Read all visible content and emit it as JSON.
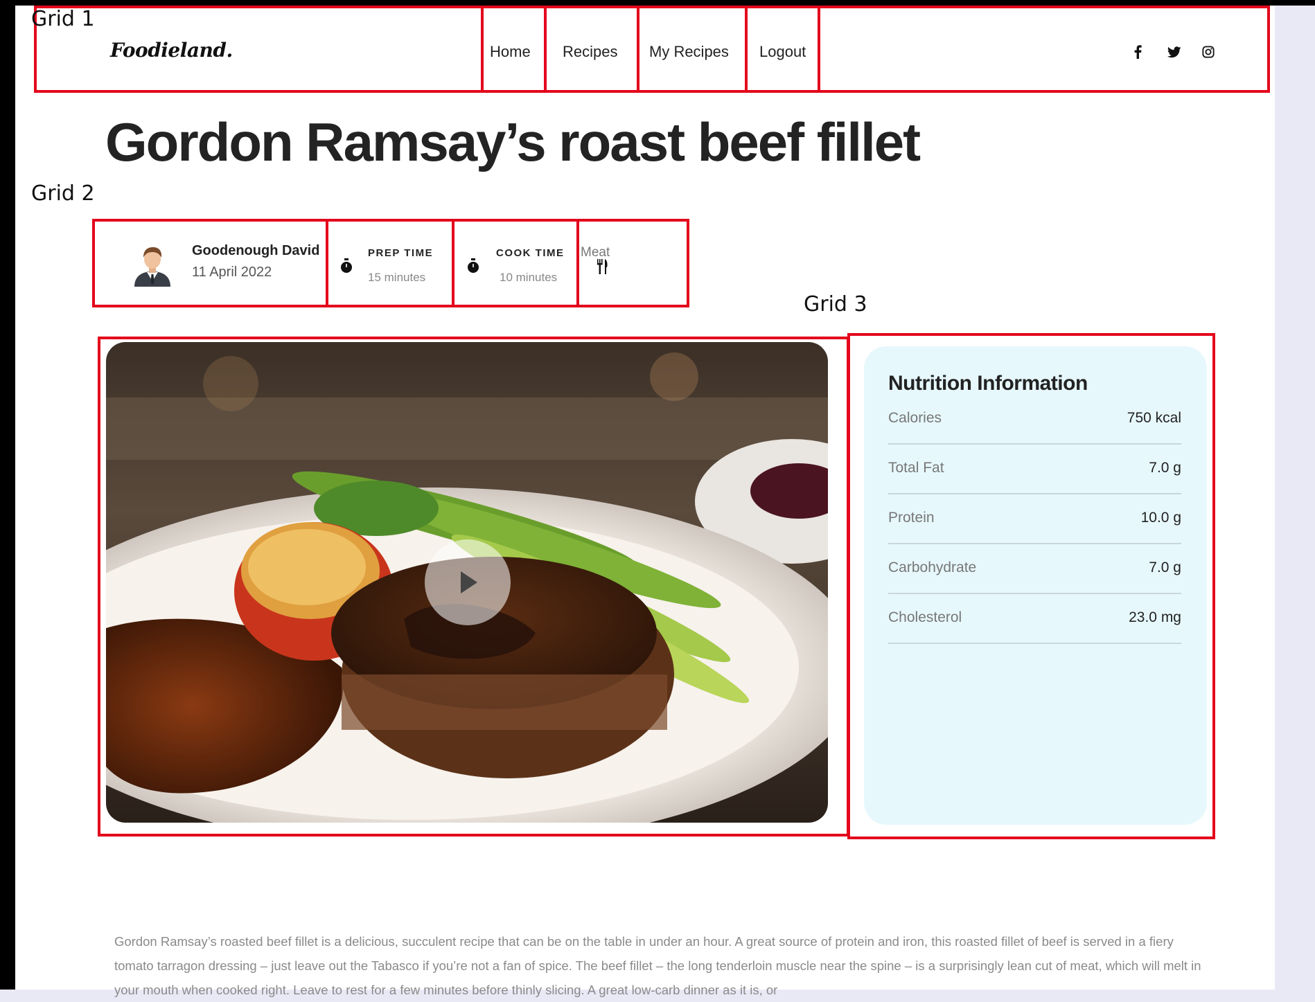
{
  "annotations": {
    "grid1": "Grid 1",
    "grid2": "Grid 2",
    "grid3": "Grid 3"
  },
  "header": {
    "logo": "Foodieland.",
    "nav": [
      "Home",
      "Recipes",
      "My Recipes",
      "Logout"
    ],
    "social_icons": [
      "facebook-icon",
      "twitter-icon",
      "instagram-icon"
    ]
  },
  "recipe": {
    "title": "Gordon Ramsay’s roast beef fillet",
    "author": "Goodenough David",
    "date": "11 April 2022",
    "prep_label": "PREP TIME",
    "prep_value": "15 minutes",
    "cook_label": "COOK TIME",
    "cook_value": "10 minutes",
    "category": "Meat"
  },
  "nutrition": {
    "title": "Nutrition Information",
    "rows": [
      {
        "name": "Calories",
        "value": "750 kcal"
      },
      {
        "name": "Total Fat",
        "value": "7.0 g"
      },
      {
        "name": "Protein",
        "value": "10.0 g"
      },
      {
        "name": "Carbohydrate",
        "value": "7.0 g"
      },
      {
        "name": "Cholesterol",
        "value": "23.0 mg"
      }
    ]
  },
  "description": "Gordon Ramsay’s roasted beef fillet is a delicious, succulent recipe that can be on the table in under an hour. A great source of protein and iron, this roasted fillet of beef is served in a fiery tomato tarragon dressing – just leave out the Tabasco if you’re not a fan of spice. The beef fillet – the long tenderloin muscle near the spine – is a surprisingly lean cut of meat, which will melt in your mouth when cooked right. Leave to rest for a few minutes before thinly slicing. A great low-carb dinner as it is, or",
  "colors": {
    "annotation_red": "#e3061c",
    "nutrition_bg": "#e7f8fc",
    "page_bg": "#e9e9f6"
  }
}
